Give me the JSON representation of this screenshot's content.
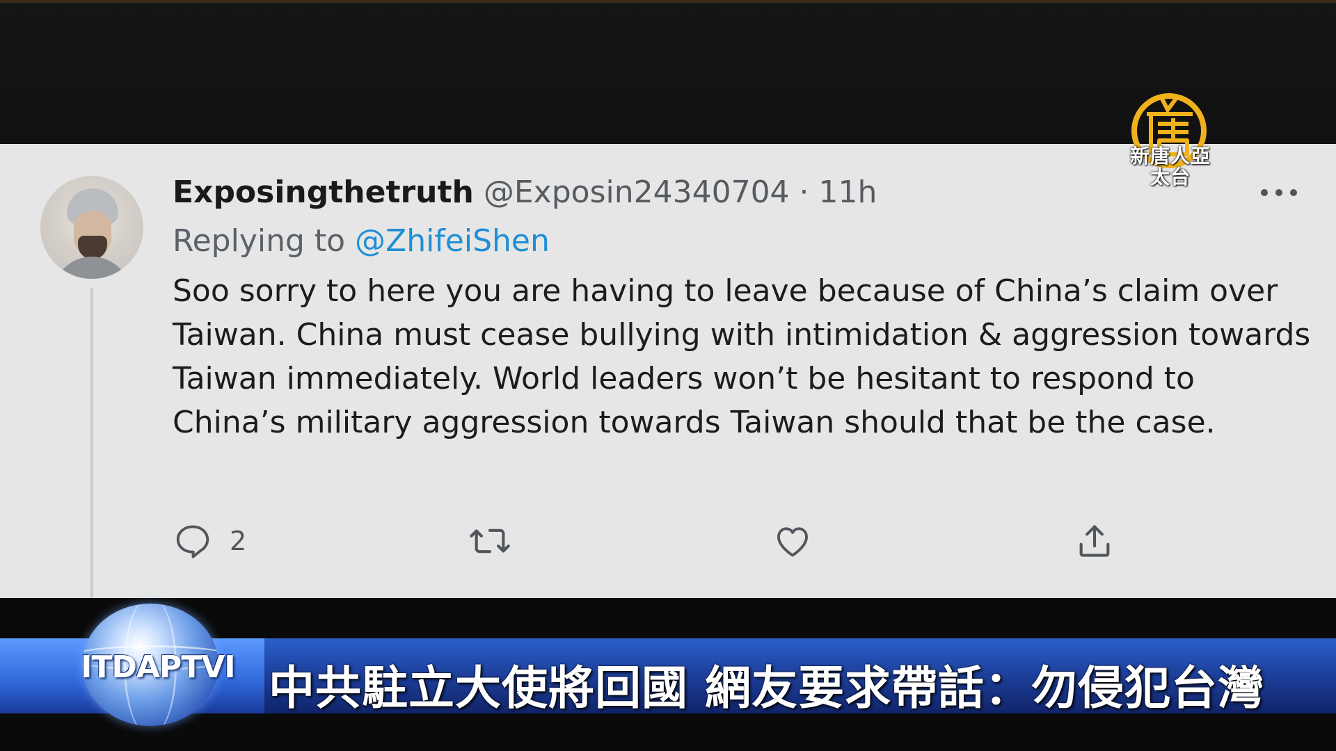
{
  "tweet": {
    "display_name": "Exposingthetruth",
    "handle": "@Exposin24340704",
    "separator": " · ",
    "time": "11h",
    "replying_prefix": "Replying to ",
    "replying_handle": "@ZhifeiShen",
    "body": "Soo sorry to here you are having to leave because of China’s claim over Taiwan. China must cease bullying with intimidation & aggression towards Taiwan immediately. World leaders won’t be hesitant to respond to China’s military aggression towards Taiwan should that be the case.",
    "reply_count": "2",
    "icons": {
      "reply": "reply-icon",
      "retweet": "retweet-icon",
      "like": "heart-icon",
      "share": "share-icon",
      "more": "more-icon"
    }
  },
  "watermark": {
    "logo_text": "新唐人亞太台"
  },
  "lower_third": {
    "station": "ITDAPTVI",
    "headline": "中共駐立大使將回國  網友要求帶話：勿侵犯台灣"
  },
  "colors": {
    "card_background": "#e6e6e6",
    "link_blue": "#1d8fd6",
    "banner_blue": "#1d3f9a",
    "logo_gold": "#f0b21c"
  }
}
